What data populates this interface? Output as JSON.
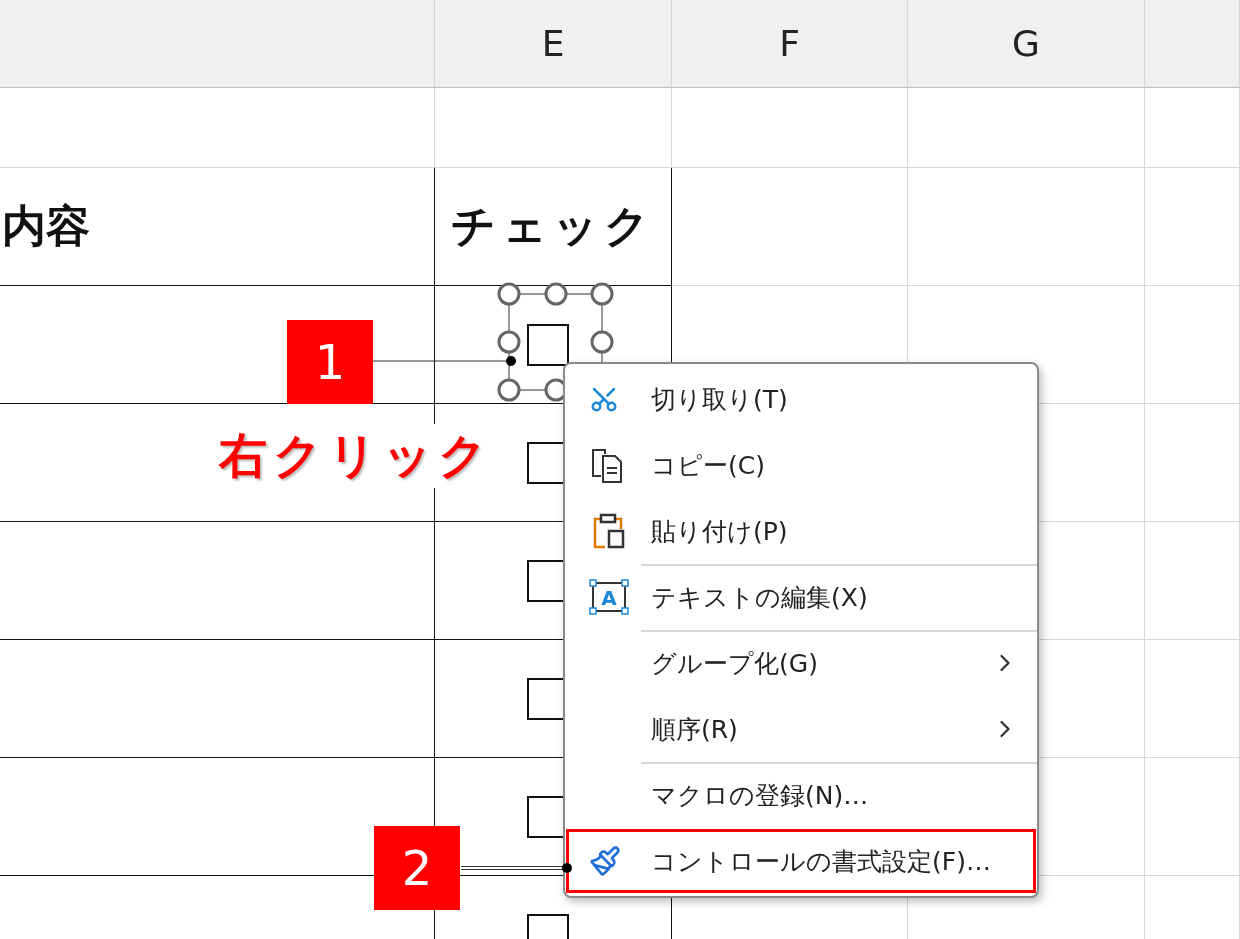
{
  "column_headers": [
    "E",
    "F",
    "G"
  ],
  "table": {
    "header": [
      "内容",
      "チェック"
    ],
    "rows": [
      {
        "checked": false,
        "selected": true
      },
      {
        "checked": false,
        "selected": false
      },
      {
        "checked": false,
        "selected": false
      },
      {
        "checked": false,
        "selected": false
      },
      {
        "checked": false,
        "selected": false
      },
      {
        "checked": false,
        "selected": false
      }
    ]
  },
  "callouts": [
    {
      "number": "1",
      "note": "右クリック"
    },
    {
      "number": "2"
    }
  ],
  "context_menu": {
    "items": [
      {
        "kind": "cut",
        "label": "切り取り(T)",
        "separator_before": false,
        "submenu": false,
        "highlighted": false
      },
      {
        "kind": "copy",
        "label": "コピー(C)",
        "separator_before": false,
        "submenu": false,
        "highlighted": false
      },
      {
        "kind": "paste",
        "label": "貼り付け(P)",
        "separator_before": false,
        "submenu": false,
        "highlighted": false
      },
      {
        "kind": "edit_text",
        "icon_text": "A",
        "label": "テキストの編集(X)",
        "separator_before": true,
        "submenu": false,
        "highlighted": false
      },
      {
        "kind": "none",
        "label": "グループ化(G)",
        "separator_before": true,
        "submenu": true,
        "highlighted": false
      },
      {
        "kind": "none",
        "label": "順序(R)",
        "separator_before": false,
        "submenu": true,
        "highlighted": false
      },
      {
        "kind": "none",
        "label": "マクロの登録(N)…",
        "separator_before": true,
        "submenu": false,
        "highlighted": false
      },
      {
        "kind": "format",
        "label": "コントロールの書式設定(F)…",
        "separator_before": false,
        "submenu": false,
        "highlighted": true
      }
    ]
  }
}
